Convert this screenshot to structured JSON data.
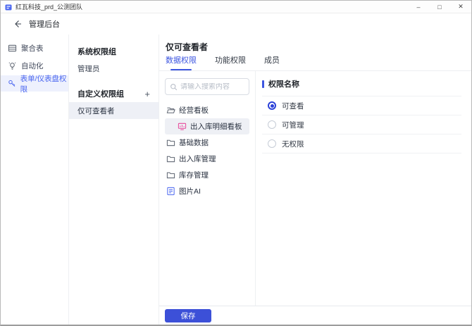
{
  "window": {
    "title": "红瓦科技_prd_公测团队",
    "controls": {
      "minimize": "–",
      "maximize": "□",
      "close": "✕"
    }
  },
  "header": {
    "back_label": "管理后台"
  },
  "nav": {
    "items": [
      {
        "label": "聚合表",
        "icon": "aggregate-table-icon",
        "active": false
      },
      {
        "label": "自动化",
        "icon": "automation-bulb-icon",
        "active": false
      },
      {
        "label": "表单/仪表盘权限",
        "icon": "key-icon",
        "active": true
      }
    ]
  },
  "groups": {
    "system_heading": "系统权限组",
    "system_items": [
      {
        "label": "管理员"
      }
    ],
    "custom_heading": "自定义权限组",
    "add_label": "+",
    "custom_items": [
      {
        "label": "仅可查看者",
        "selected": true
      }
    ]
  },
  "main": {
    "title": "仅可查看者",
    "tabs": [
      {
        "label": "数据权限",
        "active": true
      },
      {
        "label": "功能权限",
        "active": false
      },
      {
        "label": "成员",
        "active": false
      }
    ],
    "search": {
      "placeholder": "请输入搜索内容",
      "value": ""
    },
    "tree": [
      {
        "label": "经营看板",
        "icon": "folder-open-icon",
        "level": 0,
        "selected": false
      },
      {
        "label": "出入库明细看板",
        "icon": "dashboard-icon",
        "level": 1,
        "selected": true
      },
      {
        "label": "基础数据",
        "icon": "folder-icon",
        "level": 0,
        "selected": false
      },
      {
        "label": "出入库管理",
        "icon": "folder-icon",
        "level": 0,
        "selected": false
      },
      {
        "label": "库存管理",
        "icon": "folder-icon",
        "level": 0,
        "selected": false
      },
      {
        "label": "图片AI",
        "icon": "form-icon",
        "level": 0,
        "selected": false
      }
    ],
    "permission": {
      "heading": "权限名称",
      "options": [
        {
          "label": "可查看",
          "selected": true
        },
        {
          "label": "可管理",
          "selected": false
        },
        {
          "label": "无权限",
          "selected": false
        }
      ]
    },
    "save_label": "保存"
  },
  "colors": {
    "accent": "#3d56e0",
    "nav_active_bg": "#eef1fd",
    "nav_active_text": "#4c68f0",
    "selected_row_bg": "#eef0f5",
    "dashboard_icon": "#e8489b",
    "form_icon": "#4c68f0",
    "save_button_bg": "#3c50d8"
  }
}
